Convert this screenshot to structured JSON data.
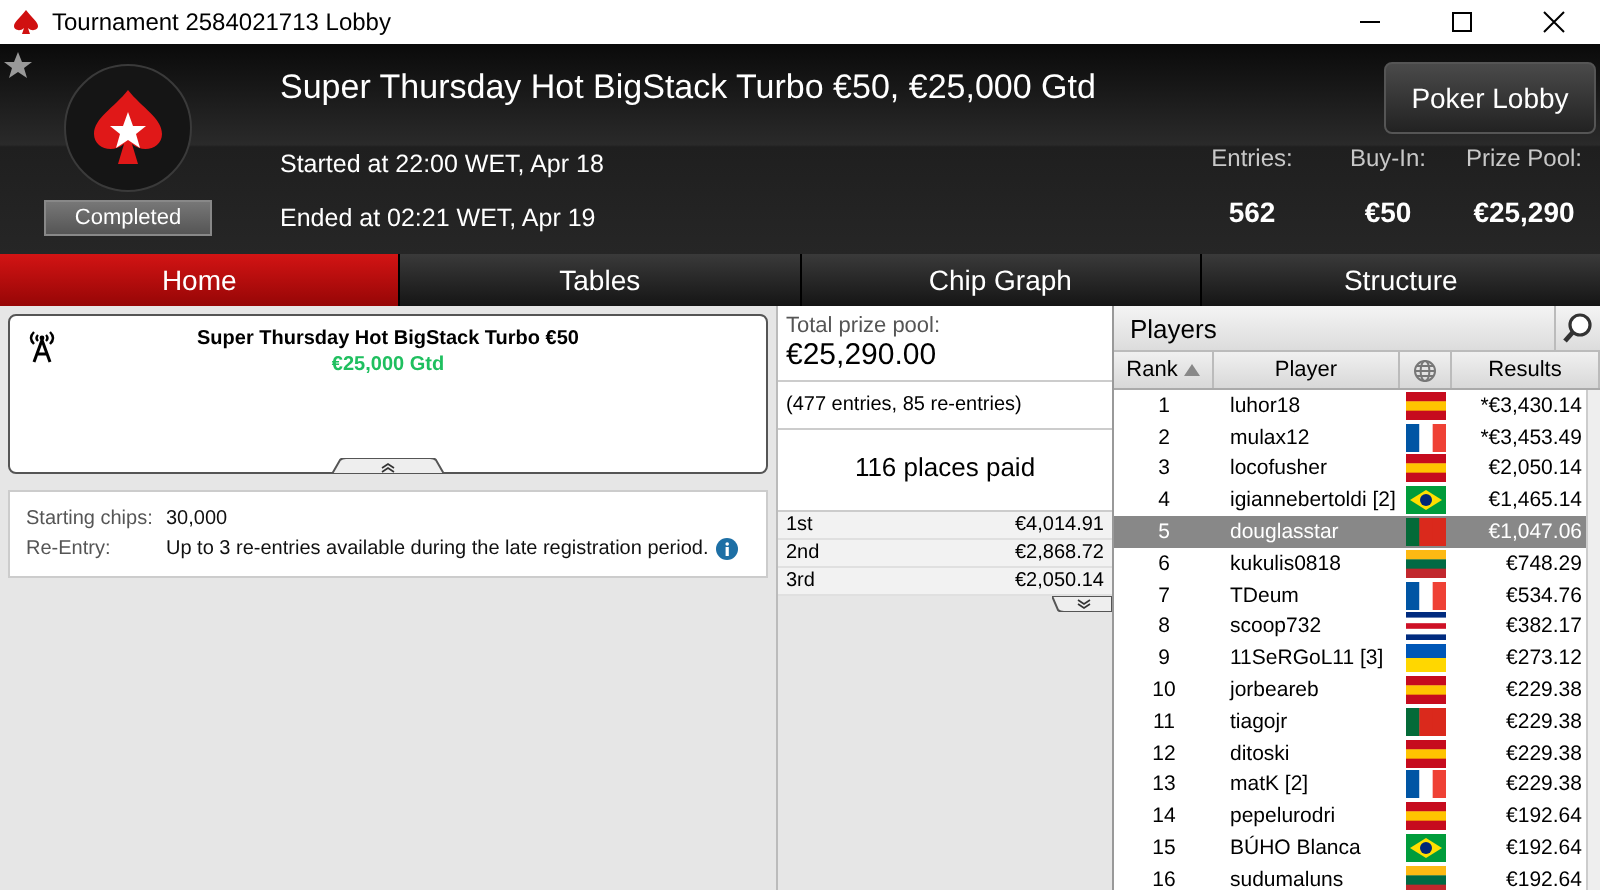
{
  "window": {
    "title": "Tournament 2584021713 Lobby"
  },
  "header": {
    "title": "Super Thursday Hot BigStack Turbo €50, €25,000 Gtd",
    "status": "Completed",
    "started": "Started at 22:00 WET, Apr 18",
    "ended": "Ended at 02:21 WET, Apr 19",
    "lobby_button": "Poker Lobby",
    "stats": [
      {
        "label": "Entries:",
        "value": "562"
      },
      {
        "label": "Buy-In:",
        "value": "€50"
      },
      {
        "label": "Prize Pool:",
        "value": "€25,290"
      }
    ]
  },
  "tabs": [
    {
      "label": "Home",
      "selected": true
    },
    {
      "label": "Tables",
      "selected": false
    },
    {
      "label": "Chip Graph",
      "selected": false
    },
    {
      "label": "Structure",
      "selected": false
    }
  ],
  "info_card": {
    "name": "Super Thursday Hot BigStack Turbo €50",
    "guarantee": "€25,000 Gtd"
  },
  "details": [
    {
      "label": "Starting chips:",
      "value": "30,000",
      "info": false
    },
    {
      "label": "Re-Entry:",
      "value": "Up to 3 re-entries available during the late registration period.",
      "info": true
    }
  ],
  "prizes": {
    "label": "Total prize pool:",
    "total": "€25,290.00",
    "entries": "(477 entries, 85 re-entries)",
    "places_paid": "116 places paid",
    "rows": [
      {
        "place": "1st",
        "amount": "€4,014.91"
      },
      {
        "place": "2nd",
        "amount": "€2,868.72"
      },
      {
        "place": "3rd",
        "amount": "€2,050.14"
      }
    ]
  },
  "players": {
    "title": "Players",
    "columns": [
      "Rank",
      "Player",
      "Results"
    ],
    "rows": [
      {
        "rank": "1",
        "player": "luhor18",
        "kind": "es",
        "result": "*€3,430.14",
        "selected": false
      },
      {
        "rank": "2",
        "player": "mulax12",
        "kind": "fr",
        "result": "*€3,453.49",
        "selected": false
      },
      {
        "rank": "3",
        "player": "locofusher",
        "kind": "es",
        "result": "€2,050.14",
        "selected": false
      },
      {
        "rank": "4",
        "player": "igiannebertoldi [2]",
        "kind": "br",
        "result": "€1,465.14",
        "selected": false
      },
      {
        "rank": "5",
        "player": "douglasstar",
        "kind": "pt",
        "result": "€1,047.06",
        "selected": true
      },
      {
        "rank": "6",
        "player": "kukulis0818",
        "kind": "lt",
        "result": "€748.29",
        "selected": false
      },
      {
        "rank": "7",
        "player": "TDeum",
        "kind": "fr",
        "result": "€534.76",
        "selected": false
      },
      {
        "rank": "8",
        "player": "scoop732",
        "kind": "cr",
        "result": "€382.17",
        "selected": false
      },
      {
        "rank": "9",
        "player": "11SeRGoL11 [3]",
        "kind": "ua",
        "result": "€273.12",
        "selected": false
      },
      {
        "rank": "10",
        "player": "jorbeareb",
        "kind": "es",
        "result": "€229.38",
        "selected": false
      },
      {
        "rank": "11",
        "player": "tiagojr",
        "kind": "pt",
        "result": "€229.38",
        "selected": false
      },
      {
        "rank": "12",
        "player": "ditoski",
        "kind": "es",
        "result": "€229.38",
        "selected": false
      },
      {
        "rank": "13",
        "player": "matK [2]",
        "kind": "fr",
        "result": "€229.38",
        "selected": false
      },
      {
        "rank": "14",
        "player": "pepelurodri",
        "kind": "es",
        "result": "€192.64",
        "selected": false
      },
      {
        "rank": "15",
        "player": "BÚHO Blanca",
        "kind": "br",
        "result": "€192.64",
        "selected": false
      },
      {
        "rank": "16",
        "player": "sudumaluns",
        "kind": "lt",
        "result": "€192.64",
        "selected": false
      }
    ]
  }
}
